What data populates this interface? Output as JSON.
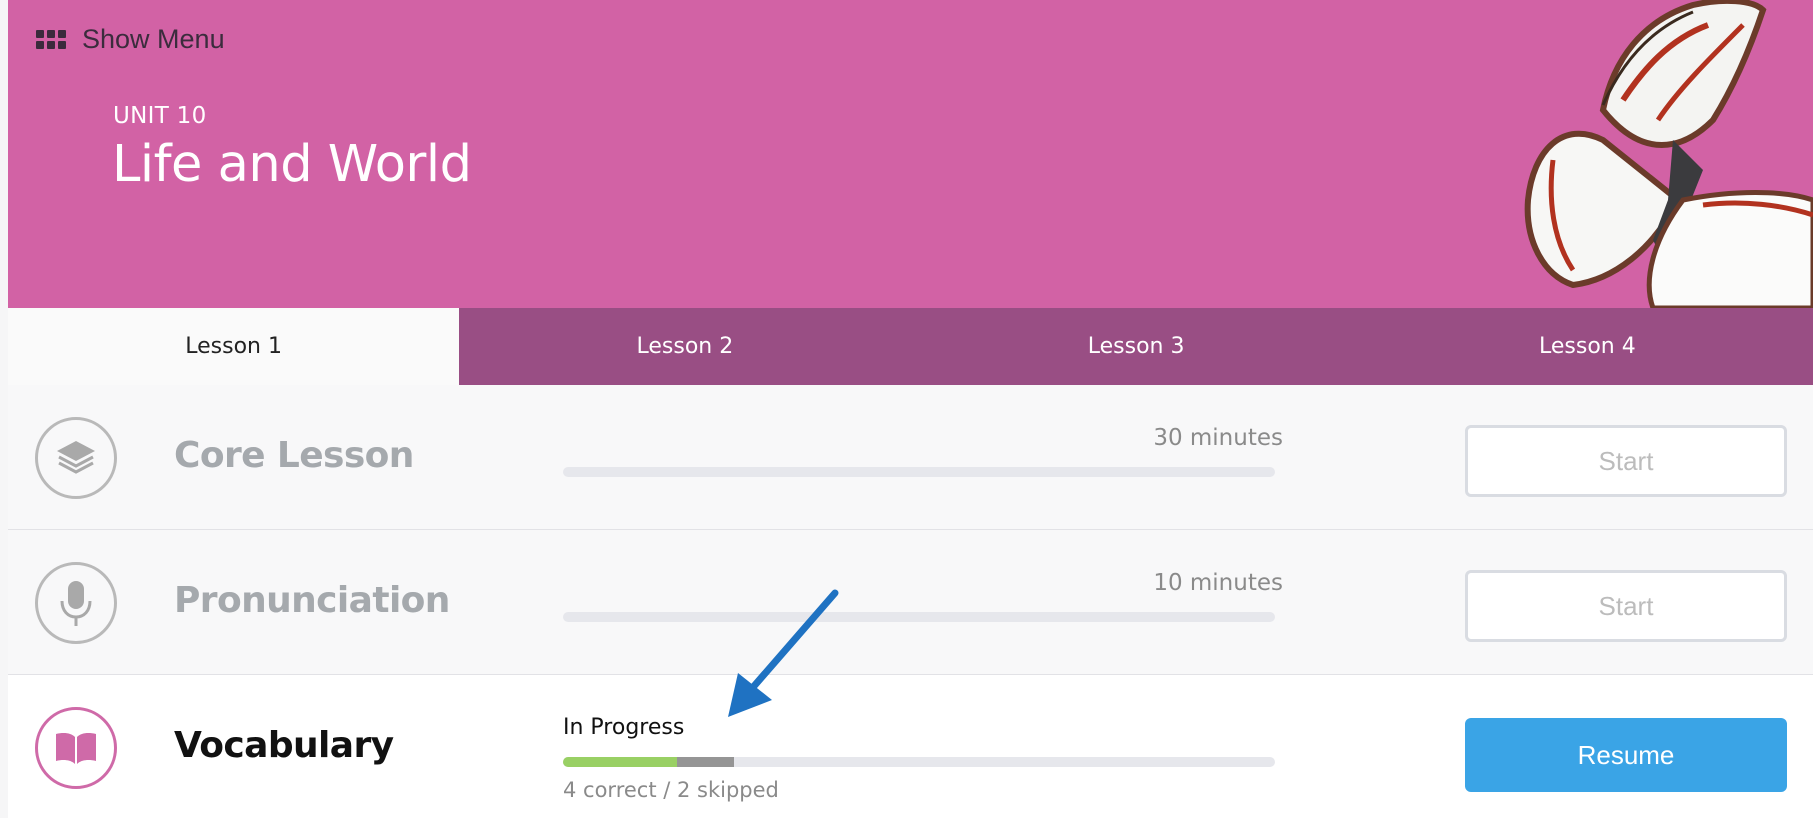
{
  "header": {
    "menu_label": "Show Menu",
    "unit_label": "UNIT 10",
    "title": "Life and World",
    "background_color": "#d262a5"
  },
  "tabs": [
    {
      "label": "Lesson 1",
      "active": true
    },
    {
      "label": "Lesson 2",
      "active": false
    },
    {
      "label": "Lesson 3",
      "active": false
    },
    {
      "label": "Lesson 4",
      "active": false
    }
  ],
  "activities": [
    {
      "name": "Core Lesson",
      "icon": "layers-icon",
      "duration": "30 minutes",
      "button": "Start",
      "progress_correct": 0,
      "progress_skipped": 0
    },
    {
      "name": "Pronunciation",
      "icon": "microphone-icon",
      "duration": "10 minutes",
      "button": "Start",
      "progress_correct": 0,
      "progress_skipped": 0
    },
    {
      "name": "Vocabulary",
      "icon": "book-icon",
      "status": "In Progress",
      "stats": "4 correct / 2 skipped",
      "button": "Resume",
      "progress_correct": 0.16,
      "progress_skipped": 0.08
    }
  ],
  "colors": {
    "tab_inactive": "#994e84",
    "resume_button": "#3aa4e6",
    "progress_correct": "#99d064",
    "progress_skipped": "#959595",
    "annotation_arrow": "#1f72c2"
  }
}
